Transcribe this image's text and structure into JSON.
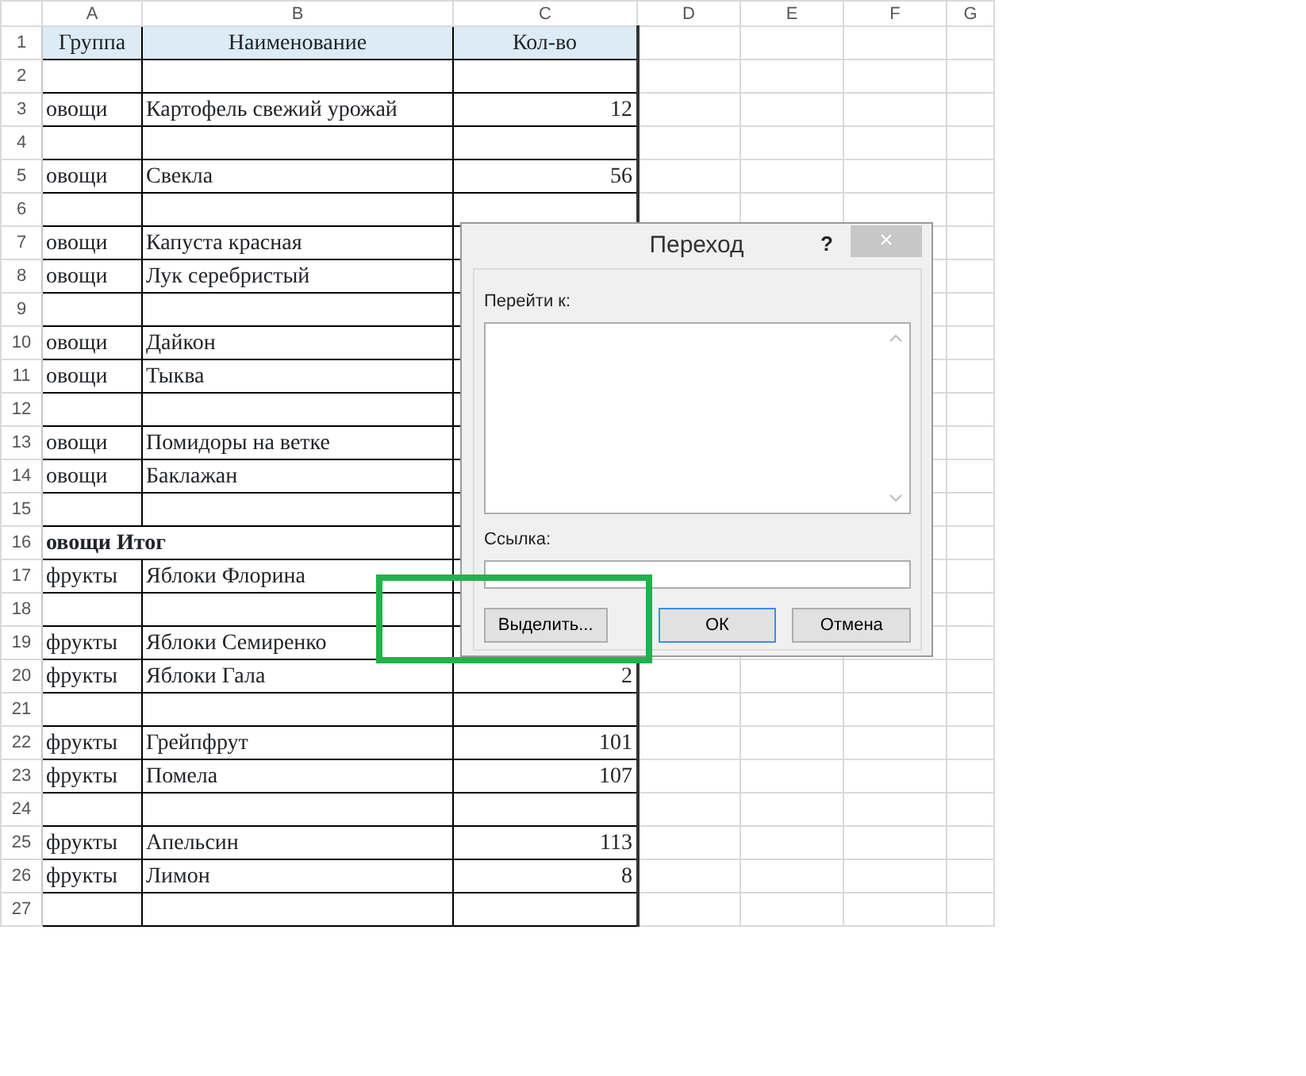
{
  "sheet": {
    "columns": [
      "A",
      "B",
      "C",
      "D",
      "E",
      "F",
      "G"
    ],
    "rows": [
      {
        "number": "1",
        "kind": "header",
        "group": "Группа",
        "name": "Наименование",
        "qty": "Кол-во"
      },
      {
        "number": "2",
        "kind": "data"
      },
      {
        "number": "3",
        "kind": "data",
        "group": "овощи",
        "name": "Картофель свежий урожай",
        "qty": "12"
      },
      {
        "number": "4",
        "kind": "data"
      },
      {
        "number": "5",
        "kind": "data",
        "group": "овощи",
        "name": "Свекла",
        "qty": "56"
      },
      {
        "number": "6",
        "kind": "data"
      },
      {
        "number": "7",
        "kind": "data",
        "group": "овощи",
        "name": "Капуста красная"
      },
      {
        "number": "8",
        "kind": "data",
        "group": "овощи",
        "name": "Лук серебристый"
      },
      {
        "number": "9",
        "kind": "data"
      },
      {
        "number": "10",
        "kind": "data",
        "group": "овощи",
        "name": "Дайкон"
      },
      {
        "number": "11",
        "kind": "data",
        "group": "овощи",
        "name": "Тыква"
      },
      {
        "number": "12",
        "kind": "data"
      },
      {
        "number": "13",
        "kind": "data",
        "group": "овощи",
        "name": "Помидоры на ветке"
      },
      {
        "number": "14",
        "kind": "data",
        "group": "овощи",
        "name": "Баклажан"
      },
      {
        "number": "15",
        "kind": "data"
      },
      {
        "number": "16",
        "kind": "total",
        "group": "овощи Итог"
      },
      {
        "number": "17",
        "kind": "data",
        "group": "фрукты",
        "name": "Яблоки Флорина"
      },
      {
        "number": "18",
        "kind": "data"
      },
      {
        "number": "19",
        "kind": "data",
        "group": "фрукты",
        "name": "Яблоки Семиренко"
      },
      {
        "number": "20",
        "kind": "data",
        "group": "фрукты",
        "name": "Яблоки Гала",
        "qty": "2"
      },
      {
        "number": "21",
        "kind": "data"
      },
      {
        "number": "22",
        "kind": "data",
        "group": "фрукты",
        "name": "Грейпфрут",
        "qty": "101"
      },
      {
        "number": "23",
        "kind": "data",
        "group": "фрукты",
        "name": "Помела",
        "qty": "107"
      },
      {
        "number": "24",
        "kind": "data"
      },
      {
        "number": "25",
        "kind": "data",
        "group": "фрукты",
        "name": "Апельсин",
        "qty": "113"
      },
      {
        "number": "26",
        "kind": "data",
        "group": "фрукты",
        "name": "Лимон",
        "qty": "8"
      },
      {
        "number": "27",
        "kind": "data"
      }
    ]
  },
  "dialog": {
    "title": "Переход",
    "help": "?",
    "close": "×",
    "goto_label": "Перейти к:",
    "reference_label": "Ссылка:",
    "buttons": [
      {
        "label": "Выделить...",
        "focused": false
      },
      {
        "label": "ОК",
        "focused": true
      },
      {
        "label": "Отмена",
        "focused": false
      }
    ]
  }
}
